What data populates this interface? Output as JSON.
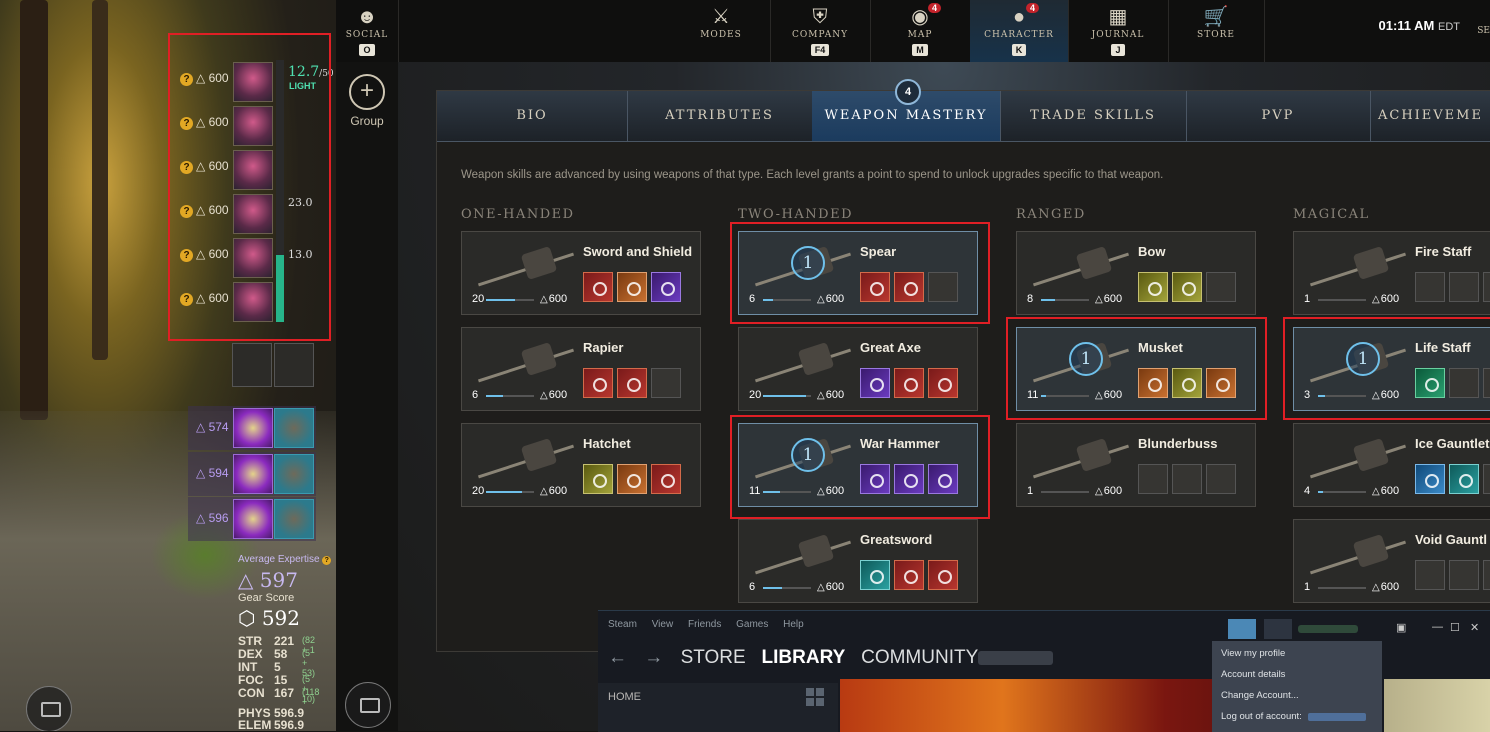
{
  "gear": {
    "slots": [
      {
        "score": "600"
      },
      {
        "score": "600"
      },
      {
        "score": "600"
      },
      {
        "score": "600"
      },
      {
        "score": "600"
      },
      {
        "score": "600"
      }
    ],
    "weight": "12.7",
    "weight_max": "/50",
    "weight_class": "LIGHT",
    "weight_fraction": 0.254,
    "side_values": [
      "23.0",
      "13.0"
    ],
    "runes": [
      {
        "score": "574"
      },
      {
        "score": "594"
      },
      {
        "score": "596"
      }
    ],
    "average_expertise_label": "Average Expertise",
    "average_expertise": "597",
    "gear_score_label": "Gear Score",
    "gear_score": "592",
    "stats": [
      {
        "name": "STR",
        "value": "221",
        "bonus": "(82 + 1"
      },
      {
        "name": "DEX",
        "value": "58",
        "bonus": "(5 + 53)"
      },
      {
        "name": "INT",
        "value": "5",
        "bonus": ""
      },
      {
        "name": "FOC",
        "value": "15",
        "bonus": "(5 + 10)"
      },
      {
        "name": "CON",
        "value": "167",
        "bonus": "(118 +"
      },
      {
        "name": "PHYS",
        "value": "596.9",
        "bonus": ""
      },
      {
        "name": "ELEM",
        "value": "596.9",
        "bonus": ""
      }
    ]
  },
  "nav": {
    "items": [
      {
        "label": "SOCIAL",
        "key": "O",
        "icon": "social-icon"
      },
      {
        "label": "MODES",
        "icon": "swords-icon"
      },
      {
        "label": "COMPANY",
        "key": "F4",
        "icon": "shield-icon"
      },
      {
        "label": "MAP",
        "key": "M",
        "icon": "globe-icon",
        "badge": "4"
      },
      {
        "label": "CHARACTER",
        "key": "K",
        "icon": "person-icon",
        "badge": "4"
      },
      {
        "label": "JOURNAL",
        "key": "J",
        "icon": "book-icon"
      },
      {
        "label": "STORE",
        "icon": "cart-icon"
      }
    ],
    "clock": "01:11 AM",
    "tz": "EDT",
    "trailing": "SE"
  },
  "group": {
    "label": "Group"
  },
  "tabs": {
    "items": [
      "BIO",
      "ATTRIBUTES",
      "WEAPON MASTERY",
      "TRADE SKILLS",
      "PVP",
      "ACHIEVEME"
    ],
    "active": "WEAPON MASTERY",
    "badge": "4"
  },
  "description": "Weapon skills are advanced by using weapons of that type. Each level grants a point to spend to unlock upgrades specific to that weapon.",
  "categories": [
    {
      "title": "ONE-HANDED",
      "weapons": [
        {
          "name": "Sword and Shield",
          "level": "20",
          "max": "600",
          "progress": 0.6
        },
        {
          "name": "Rapier",
          "level": "6",
          "max": "600",
          "progress": 0.35
        },
        {
          "name": "Hatchet",
          "level": "20",
          "max": "600",
          "progress": 0.75
        }
      ]
    },
    {
      "title": "TWO-HANDED",
      "weapons": [
        {
          "name": "Spear",
          "level": "6",
          "max": "600",
          "points": "1",
          "progress": 0.2
        },
        {
          "name": "Great Axe",
          "level": "20",
          "max": "600",
          "progress": 0.9
        },
        {
          "name": "War Hammer",
          "level": "11",
          "max": "600",
          "points": "1",
          "progress": 0.35
        },
        {
          "name": "Greatsword",
          "level": "6",
          "max": "600",
          "progress": 0.4
        }
      ]
    },
    {
      "title": "RANGED",
      "weapons": [
        {
          "name": "Bow",
          "level": "8",
          "max": "600",
          "progress": 0.3
        },
        {
          "name": "Musket",
          "level": "11",
          "max": "600",
          "points": "1",
          "progress": 0.1
        },
        {
          "name": "Blunderbuss",
          "level": "1",
          "max": "600",
          "progress": 0.0
        }
      ]
    },
    {
      "title": "MAGICAL",
      "weapons": [
        {
          "name": "Fire Staff",
          "level": "1",
          "max": "600",
          "progress": 0.0
        },
        {
          "name": "Life Staff",
          "level": "3",
          "max": "600",
          "points": "1",
          "progress": 0.15
        },
        {
          "name": "Ice Gauntlet",
          "level": "4",
          "max": "600",
          "progress": 0.1
        },
        {
          "name": "Void Gauntl",
          "level": "1",
          "max": "600",
          "progress": 0.0
        }
      ]
    }
  ],
  "steam": {
    "menu": [
      "Steam",
      "View",
      "Friends",
      "Games",
      "Help"
    ],
    "nav": [
      "STORE",
      "LIBRARY",
      "COMMUNITY"
    ],
    "home": "HOME",
    "dropdown": [
      "View my profile",
      "Account details",
      "Change Account...",
      "Log out of account:"
    ]
  }
}
